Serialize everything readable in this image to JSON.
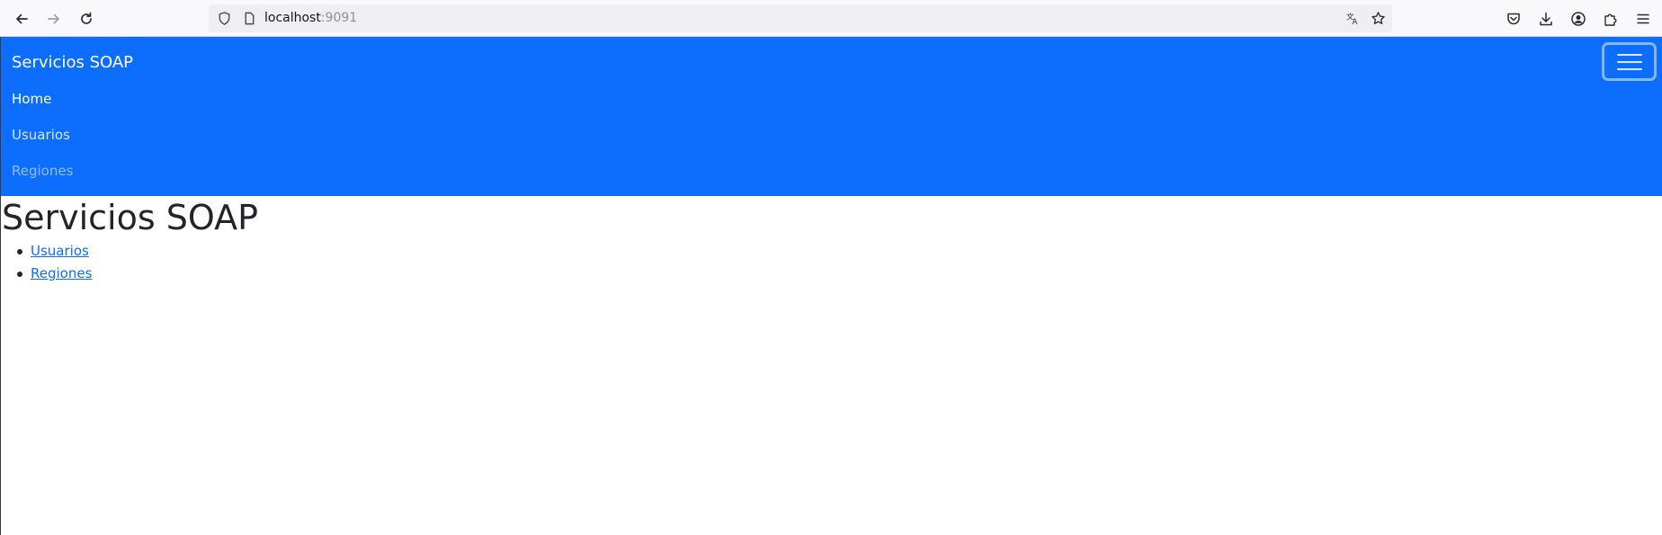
{
  "browser": {
    "url_host": "localhost",
    "url_port": ":9091",
    "icons": {
      "back": "arrow-left-icon",
      "forward": "arrow-right-icon",
      "reload": "reload-icon",
      "tracking": "shield-icon",
      "page_info": "page-icon",
      "translate": "translate-icon",
      "bookmark": "star-icon",
      "pocket": "pocket-icon",
      "downloads": "download-icon",
      "account": "account-icon",
      "extensions": "puzzle-icon",
      "menu": "hamburger-menu-icon"
    }
  },
  "navbar": {
    "brand": "Servicios SOAP",
    "background_color": "#0d6efd",
    "links": [
      {
        "label": "Home"
      },
      {
        "label": "Usuarios"
      },
      {
        "label": "Regiones"
      }
    ],
    "toggler_icon": "hamburger-icon"
  },
  "main": {
    "title": "Servicios SOAP",
    "links": [
      {
        "label": "Usuarios"
      },
      {
        "label": "Regiones"
      }
    ],
    "link_color": "#0d6efd"
  }
}
